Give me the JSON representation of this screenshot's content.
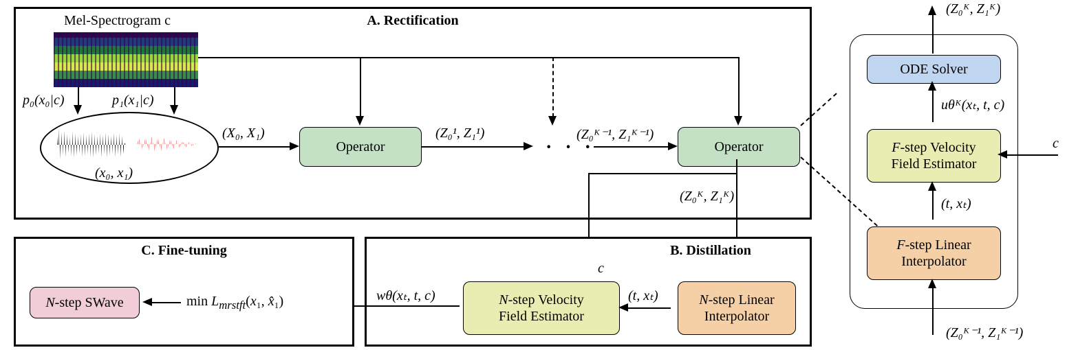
{
  "panelA": {
    "title": "A. Rectification",
    "mel_caption": "Mel-Spectrogram c",
    "p0": "p₀(x₀|c)",
    "p1": "p₁(x₁|c)",
    "x0x1": "(x₀, x₁)",
    "X0X1": "(X₀, X₁)",
    "operator": "Operator",
    "Z1": "(Z₀¹, Z₁¹)",
    "ZKm1": "(Z₀ᴷ⁻¹, Z₁ᴷ⁻¹)",
    "ZK_out": "(Z₀ᴷ, Z₁ᴷ)"
  },
  "panelB": {
    "title": "B. Distillation",
    "c_label": "c",
    "estimator": "N-step Velocity Field Estimator",
    "interpolator": "N-step Linear Interpolator",
    "txt_label": "(t, xₜ)",
    "w_label": "wθ(xₜ, t, c)"
  },
  "panelC": {
    "title": "C. Fine-tuning",
    "swave": "N-step SWave",
    "loss": "min Lₘᵣₛₜfₜ(x₁, x̂₁)"
  },
  "side": {
    "ode": "ODE Solver",
    "estimator": "F-step Velocity Field Estimator",
    "interpolator": "F-step Linear Interpolator",
    "u_label": "uθᴷ(xₜ, t, c)",
    "txt_label": "(t, xₜ)",
    "c_label": "c",
    "top_out": "(Z₀ᴷ, Z₁ᴷ)",
    "bottom_in": "(Z₀ᴷ⁻¹, Z₁ᴷ⁻¹)"
  }
}
